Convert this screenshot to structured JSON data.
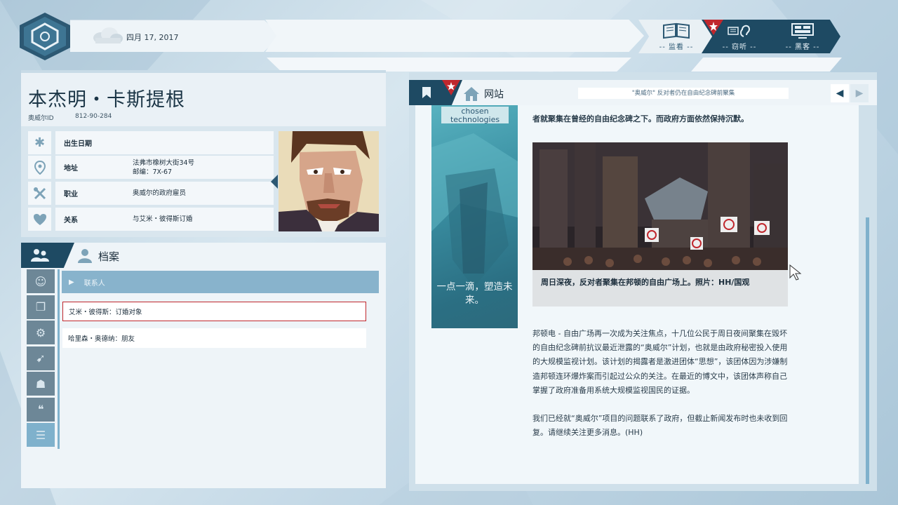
{
  "top_bar": {
    "date": "四月 17, 2017",
    "weather_icon": "cloud-icon",
    "modes": [
      {
        "label": "-- 监看 --",
        "icon": "book-icon"
      },
      {
        "label": "-- 窃听 --",
        "icon": "ear-icon"
      },
      {
        "label": "-- 黑客 --",
        "icon": "monitor-icon"
      }
    ]
  },
  "profile": {
    "name": "本杰明・卡斯提根",
    "id_label": "奥威尔ID",
    "id_value": "812-90-284",
    "fields": [
      {
        "label": "出生日期",
        "value": "",
        "icon": "asterisk-icon"
      },
      {
        "label": "地址",
        "value_line1": "法弗市橡树大街34号",
        "value_line2": "邮编：7X-67",
        "icon": "location-pin-icon"
      },
      {
        "label": "职业",
        "value": "奥威尔的政府雇员",
        "icon": "tools-icon"
      },
      {
        "label": "关系",
        "value": "与艾米・彼得斯订婚",
        "icon": "heart-icon"
      }
    ]
  },
  "files": {
    "title": "档案",
    "contacts_header": "联系人",
    "contacts": [
      "艾米・彼得斯：订婚对象",
      "哈里森・奥德纳：朋友"
    ]
  },
  "website": {
    "title": "网站",
    "url": "\"奥威尔\" 反对者仍在自由纪念碑前聚集",
    "ad_tag": "chosen technologies",
    "ad_caption": "一点一滴，塑造未来。",
    "article_top_partial": "者就聚集在曾经的自由纪念碑之下。而政府方面依然保持沉默。",
    "photo_caption": "周日深夜，反对者聚集在邦顿的自由广场上。照片：HH/国观",
    "paragraphs": [
      "邦顿电 - 自由广场再一次成为关注焦点，十几位公民于周日夜间聚集在毁坏的自由纪念碑前抗议最近泄露的“奥威尔”计划，也就是由政府秘密投入使用的大规模监视计划。该计划的揭露者是激进团体“思想”，该团体因为涉嫌制造邦顿连环爆炸案而引起过公众的关注。在最近的博文中，该团体声称自己掌握了政府准备用系统大规模监视国民的证据。",
      "我们已经就“奥威尔”项目的问题联系了政府，但截止新闻发布时也未收到回复。请继续关注更多消息。(HH)"
    ]
  },
  "colors": {
    "navy": "#1e4a63",
    "accent_red": "#c0272d",
    "light_blue": "#88b3cc",
    "panel_bg": "#eef4f8"
  }
}
